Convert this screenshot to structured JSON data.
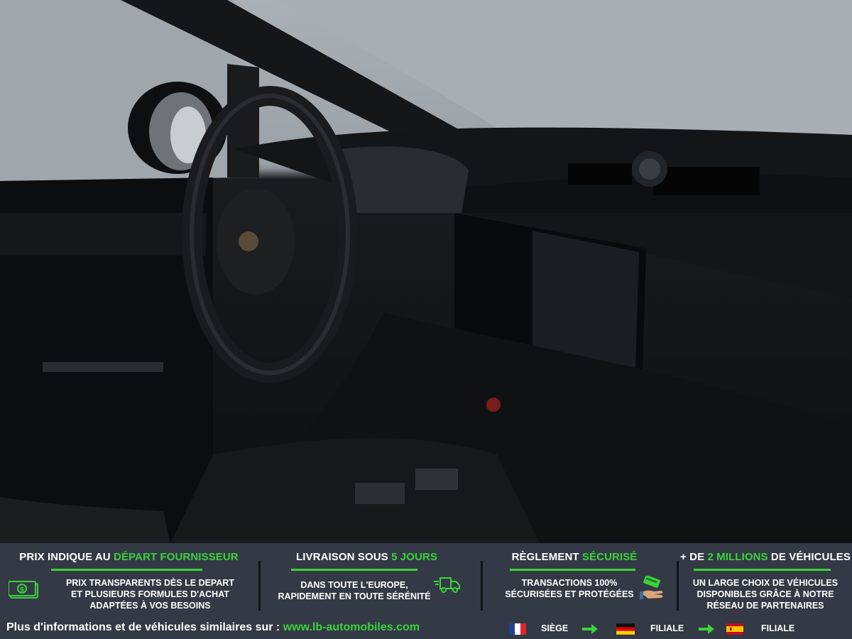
{
  "banner": {
    "features": [
      {
        "title_pre": "PRIX INDIQUE AU ",
        "title_accent": "DÉPART FOURNISSEUR",
        "title_post": "",
        "lines": [
          "PRIX TRANSPARENTS DÈS LE DEPART",
          "ET PLUSIEURS FORMULES D'ACHAT",
          "ADAPTÉES À VOS BESOINS"
        ],
        "icon": "money-icon"
      },
      {
        "title_pre": "LIVRAISON SOUS ",
        "title_accent": "5 JOURS",
        "title_post": "",
        "lines": [
          "DANS TOUTE L'EUROPE,",
          "RAPIDEMENT EN TOUTE SÉRÉNITÉ"
        ],
        "icon": "truck-icon"
      },
      {
        "title_pre": "RÈGLEMENT ",
        "title_accent": "SÉCURISÉ",
        "title_post": "",
        "lines": [
          "TRANSACTIONS 100%",
          "SÉCURISÉES ET PROTÉGÉES"
        ],
        "icon": "payment-hand-icon"
      },
      {
        "title_pre": "+ DE ",
        "title_accent": "2 MILLIONS",
        "title_post": " DE VÉHICULES",
        "lines": [
          "UN LARGE CHOIX DE VÉHICULES",
          "DISPONIBLES GRÂCE À NOTRE",
          "RÉSEAU DE PARTENAIRES"
        ],
        "icon": ""
      }
    ],
    "footer": {
      "info_text": "Plus d'informations et de véhicules similaires sur : ",
      "link_text": "www.lb-automobiles.com",
      "locations": [
        {
          "flag": "france-flag-icon",
          "label": "SIÈGE"
        },
        {
          "flag": "germany-flag-icon",
          "label": "FILIALE"
        },
        {
          "flag": "spain-flag-icon",
          "label": "FILIALE"
        }
      ]
    },
    "colors": {
      "background": "#333a45",
      "accent": "#3cd23c",
      "text": "#ffffff"
    }
  }
}
